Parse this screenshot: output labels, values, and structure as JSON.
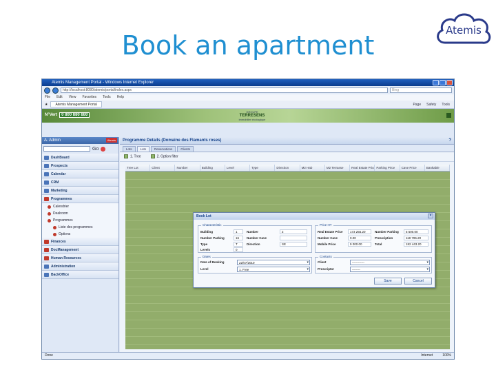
{
  "slide": {
    "title": "Book an apartment",
    "logo_text": "Atemis"
  },
  "browser": {
    "title": "Atemis Management Portal - Windows Internet Explorer",
    "url": "http://localhost:8080/atemis/portal/index.aspx",
    "search_placeholder": "Bing",
    "menu": [
      "File",
      "Edit",
      "View",
      "Favorites",
      "Tools",
      "Help"
    ],
    "tab_label": "Atemis Management Portal",
    "tools": [
      "Page",
      "Safety",
      "Tools"
    ],
    "status": "Done",
    "status_zone": "Internet",
    "zoom": "100%"
  },
  "banner": {
    "nvert_label": "N°Vert",
    "phone": "0 800 880 880",
    "brand_name": "TERRESENS",
    "brand_group": "GROUPE",
    "brand_tagline": "immobilier écologique"
  },
  "sidebar": {
    "user": "A. Admin",
    "user_badge": "Atemis",
    "go_label": "Go",
    "items": [
      {
        "label": "DashBoard",
        "color": "#4a74b8"
      },
      {
        "label": "Prospects",
        "color": "#4a74b8"
      },
      {
        "label": "Calendar",
        "color": "#4a74b8"
      },
      {
        "label": "CRM",
        "color": "#4a74b8"
      },
      {
        "label": "Marketing",
        "color": "#4a74b8"
      },
      {
        "label": "Programmes",
        "color": "#c0392b"
      }
    ],
    "sub_items": [
      "Calendrier",
      "Dealroom",
      "Programmes",
      "Liste des programmes",
      "Options"
    ],
    "items_after": [
      {
        "label": "Finances",
        "color": "#c0392b"
      },
      {
        "label": "DocManagement",
        "color": "#c0392b"
      },
      {
        "label": "Human Resources",
        "color": "#c0392b"
      },
      {
        "label": "Administration",
        "color": "#4a74b8"
      },
      {
        "label": "BackOffice",
        "color": "#4a74b8"
      }
    ]
  },
  "main": {
    "panel_title": "Programme Details (Domaine des Flamants roses)",
    "help": "?",
    "tabs": [
      "Lots",
      "Lots",
      "Reservations",
      "Clients"
    ],
    "toolbar": [
      "1. Tree",
      "2. Option filter"
    ],
    "columns": [
      "Tree Lot",
      "Client",
      "Number",
      "Building",
      "Level",
      "Type",
      "Direction",
      "M2 Hab",
      "M2 Terrasse",
      "Real Estate Price",
      "Parking Price",
      "Cave Price",
      "Bankable"
    ]
  },
  "dialog": {
    "title": "Book Lot",
    "characteristic_legend": "Characteristic",
    "price_legend": "Price HT",
    "dates_legend": "Dates",
    "contacts_legend": "Contacts",
    "building_label": "Building",
    "building_value": "1",
    "number_label": "Number",
    "number_value": "2",
    "parking_label": "Number Parking",
    "parking_value": "16",
    "cave_label": "Number Cave",
    "cave_value": "",
    "type_label": "Type",
    "type_value": "T",
    "direction_label": "Direction",
    "direction_value": "SE",
    "levels_label": "Levels",
    "levels_value": "0",
    "real_estate_label": "Real Estate Price",
    "real_estate_value": "173 255.20",
    "num_parking_price_label": "Number Parking",
    "num_parking_price_value": "5 500.00",
    "num_cave_price_label": "Number Cave",
    "num_cave_price_value": "0.00",
    "prescription_label": "Prescription",
    "prescription_value": "118 795.20",
    "mobile_price_label": "Mobile Price",
    "mobile_price_value": "9 000.00",
    "total_label": "Total",
    "total_value": "182 443.20",
    "date_booking_label": "Date of Booking",
    "date_booking_value": "22/07/2010",
    "level_label": "Level",
    "level_value": "1. Free",
    "client_label": "Client",
    "client_value": "------------",
    "prescriptor_label": "Prescriptor",
    "prescriptor_value": "--------",
    "save_label": "Save",
    "cancel_label": "Cancel"
  }
}
